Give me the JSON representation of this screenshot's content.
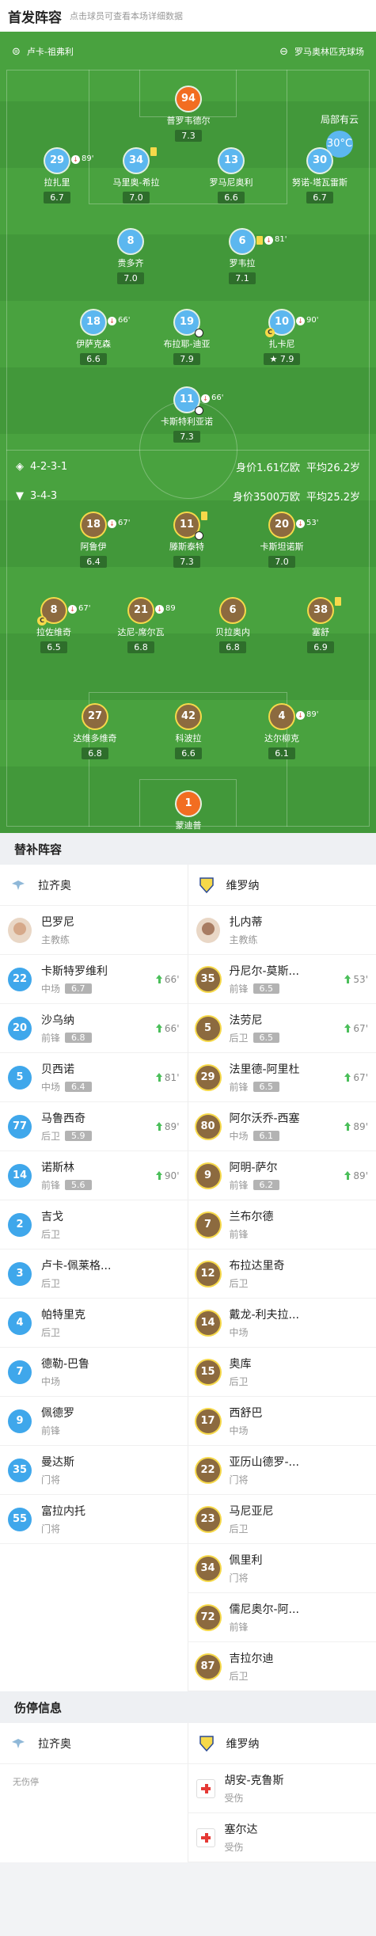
{
  "header": {
    "title": "首发阵容",
    "hint": "点击球员可查看本场详细数据"
  },
  "pitch": {
    "home_team": "卢卡-祖弗利",
    "venue": "罗马奥林匹克球场",
    "weather": "局部有云",
    "temperature": "30°C",
    "home_formation": "4-2-3-1",
    "home_height": "身价1.61亿欧",
    "home_age": "平均26.2岁",
    "away_formation": "3-4-3",
    "away_value": "身价3500万欧",
    "away_age": "平均25.2岁",
    "players": [
      {
        "num": "94",
        "name": "普罗韦德尔",
        "rating": "7.3",
        "team": "gk"
      },
      {
        "num": "29",
        "name": "拉扎里",
        "rating": "6.7",
        "team": "blue",
        "sub": "89'"
      },
      {
        "num": "34",
        "name": "马里奥-希拉",
        "rating": "7.0",
        "team": "blue",
        "card": "yellow"
      },
      {
        "num": "13",
        "name": "罗马尼奥利",
        "rating": "6.6",
        "team": "blue"
      },
      {
        "num": "30",
        "name": "努诺-塔瓦雷斯",
        "rating": "6.7",
        "team": "blue"
      },
      {
        "num": "8",
        "name": "贵多齐",
        "rating": "7.0",
        "team": "blue"
      },
      {
        "num": "6",
        "name": "罗韦拉",
        "rating": "7.1",
        "team": "blue",
        "sub": "81'",
        "card": "yellow"
      },
      {
        "num": "18",
        "name": "伊萨克森",
        "rating": "6.6",
        "team": "blue",
        "sub": "66'"
      },
      {
        "num": "19",
        "name": "布拉耶-迪亚",
        "rating": "7.9",
        "team": "blue",
        "goal": "true"
      },
      {
        "num": "10",
        "name": "扎卡尼",
        "rating": "7.9",
        "team": "blue",
        "sub": "90'",
        "captain": "C",
        "star": "true"
      },
      {
        "num": "11",
        "name": "卡斯特利亚诺",
        "rating": "7.3",
        "team": "blue",
        "sub": "66'",
        "goal": "true"
      },
      {
        "num": "18",
        "name": "阿鲁伊",
        "rating": "6.4",
        "team": "brown",
        "sub": "67'"
      },
      {
        "num": "11",
        "name": "滕斯泰特",
        "rating": "7.3",
        "team": "brown",
        "card": "yellow",
        "goal": "true"
      },
      {
        "num": "20",
        "name": "卡斯坦诺斯",
        "rating": "7.0",
        "team": "brown",
        "sub": "53'"
      },
      {
        "num": "8",
        "name": "拉佐维奇",
        "rating": "6.5",
        "team": "brown",
        "sub": "67'",
        "captain": "C"
      },
      {
        "num": "21",
        "name": "达尼-席尔瓦",
        "rating": "6.8",
        "team": "brown",
        "sub": "89"
      },
      {
        "num": "6",
        "name": "贝拉奥内",
        "rating": "6.8",
        "team": "brown"
      },
      {
        "num": "38",
        "name": "塞舒",
        "rating": "6.9",
        "team": "brown",
        "card": "yellow"
      },
      {
        "num": "27",
        "name": "达维多维奇",
        "rating": "6.8",
        "team": "brown"
      },
      {
        "num": "42",
        "name": "科波拉",
        "rating": "6.6",
        "team": "brown"
      },
      {
        "num": "4",
        "name": "达尔柳克",
        "rating": "6.1",
        "team": "brown",
        "sub": "89'"
      },
      {
        "num": "1",
        "name": "蒙迪普",
        "rating": "7.3",
        "team": "gk"
      }
    ]
  },
  "subs": {
    "title": "替补阵容",
    "left_team": "拉齐奥",
    "right_team": "维罗纳",
    "left_coach": {
      "name": "巴罗尼",
      "role": "主教练"
    },
    "right_coach": {
      "name": "扎内蒂",
      "role": "主教练"
    },
    "left": [
      {
        "num": "22",
        "name": "卡斯特罗维利",
        "pos": "中场",
        "rating": "6.7",
        "min": "66'"
      },
      {
        "num": "20",
        "name": "沙乌纳",
        "pos": "前锋",
        "rating": "6.8",
        "min": "66'"
      },
      {
        "num": "5",
        "name": "贝西诺",
        "pos": "中场",
        "rating": "6.4",
        "min": "81'"
      },
      {
        "num": "77",
        "name": "马鲁西奇",
        "pos": "后卫",
        "rating": "5.9",
        "min": "89'"
      },
      {
        "num": "14",
        "name": "诺斯林",
        "pos": "前锋",
        "rating": "5.6",
        "min": "90'"
      },
      {
        "num": "2",
        "name": "吉戈",
        "pos": "后卫"
      },
      {
        "num": "3",
        "name": "卢卡-佩莱格...",
        "pos": "后卫"
      },
      {
        "num": "4",
        "name": "帕特里克",
        "pos": "后卫"
      },
      {
        "num": "7",
        "name": "德勒-巴鲁",
        "pos": "中场"
      },
      {
        "num": "9",
        "name": "佩德罗",
        "pos": "前锋"
      },
      {
        "num": "35",
        "name": "曼达斯",
        "pos": "门将"
      },
      {
        "num": "55",
        "name": "富拉内托",
        "pos": "门将"
      }
    ],
    "right": [
      {
        "num": "35",
        "name": "丹尼尔-莫斯...",
        "pos": "前锋",
        "rating": "6.5",
        "min": "53'"
      },
      {
        "num": "5",
        "name": "法劳尼",
        "pos": "后卫",
        "rating": "6.5",
        "min": "67'"
      },
      {
        "num": "29",
        "name": "法里德-阿里杜",
        "pos": "前锋",
        "rating": "6.5",
        "min": "67'"
      },
      {
        "num": "80",
        "name": "阿尔沃乔-西塞",
        "pos": "中场",
        "rating": "6.1",
        "min": "89'"
      },
      {
        "num": "9",
        "name": "阿明-萨尔",
        "pos": "前锋",
        "rating": "6.2",
        "min": "89'"
      },
      {
        "num": "7",
        "name": "兰布尔德",
        "pos": "前锋"
      },
      {
        "num": "12",
        "name": "布拉达里奇",
        "pos": "后卫"
      },
      {
        "num": "14",
        "name": "戴龙-利夫拉...",
        "pos": "中场"
      },
      {
        "num": "15",
        "name": "奥库",
        "pos": "后卫"
      },
      {
        "num": "17",
        "name": "西舒巴",
        "pos": "中场"
      },
      {
        "num": "22",
        "name": "亚历山德罗-...",
        "pos": "门将"
      },
      {
        "num": "23",
        "name": "马尼亚尼",
        "pos": "后卫"
      },
      {
        "num": "34",
        "name": "佩里利",
        "pos": "门将"
      },
      {
        "num": "72",
        "name": "儒尼奥尔-阿...",
        "pos": "前锋"
      },
      {
        "num": "87",
        "name": "吉拉尔迪",
        "pos": "后卫"
      }
    ]
  },
  "injuries": {
    "title": "伤停信息",
    "left_team": "拉齐奥",
    "right_team": "维罗纳",
    "left_none": "无伤停",
    "right": [
      {
        "name": "胡安-克鲁斯",
        "status": "受伤"
      },
      {
        "name": "塞尔达",
        "status": "受伤"
      }
    ]
  }
}
